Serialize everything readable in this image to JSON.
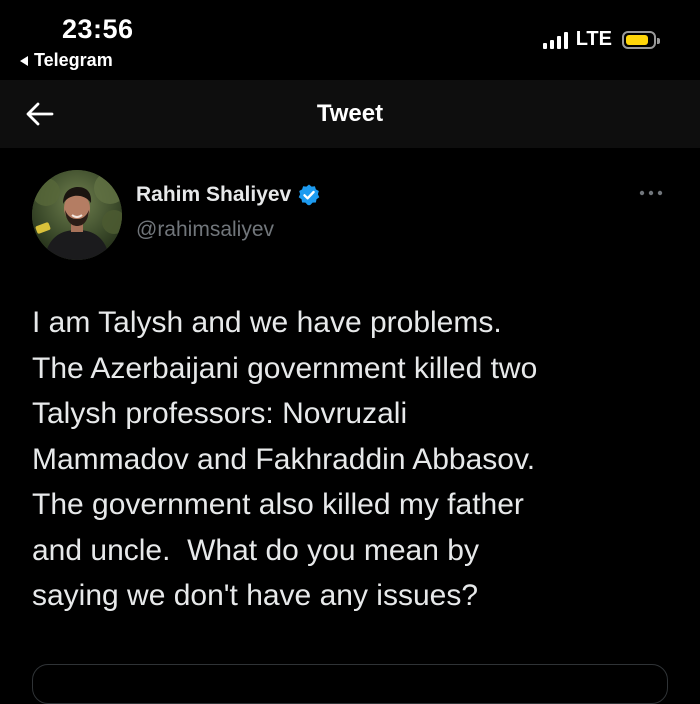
{
  "status_bar": {
    "time": "23:56",
    "back_app": "Telegram",
    "network": "LTE",
    "signal_icon": "cellular-signal-icon",
    "battery_icon": "battery-icon",
    "battery_level": 0.85,
    "battery_color": "#ffd60a"
  },
  "nav": {
    "title": "Tweet",
    "back_icon": "back-arrow-icon"
  },
  "tweet": {
    "author_name": "Rahim Shaliyev",
    "author_handle": "@rahimsaliyev",
    "verified": true,
    "verified_color": "#1d9bf0",
    "text": "I am Talysh and we have problems.\nThe Azerbaijani government killed two\nTalysh professors: Novruzali\nMammadov and Fakhraddin Abbasov.\nThe government also killed my father\nand uncle.  What do you mean by\nsaying we don't have any issues?"
  }
}
